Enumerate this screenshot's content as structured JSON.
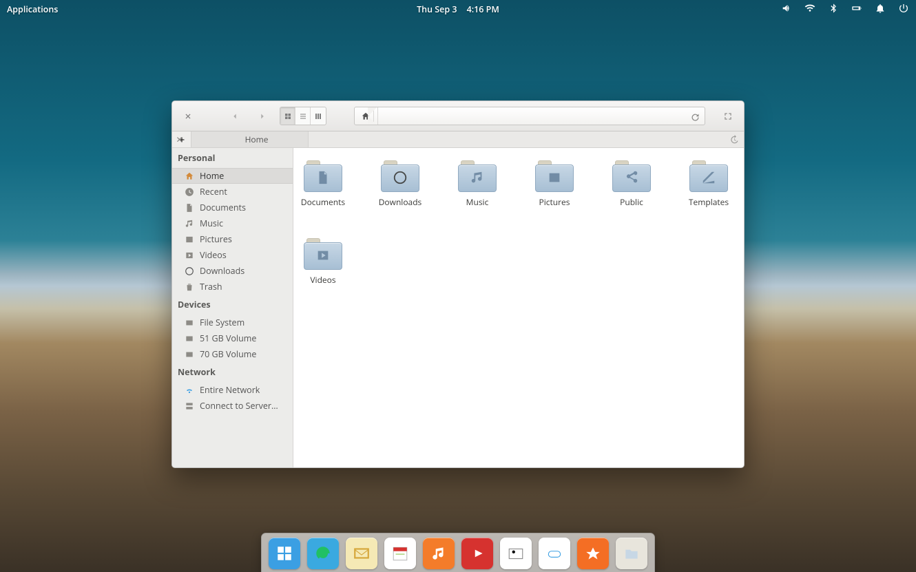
{
  "panel": {
    "applications_label": "Applications",
    "date": "Thu Sep 3",
    "time": "4:16 PM",
    "indicators": [
      "sound-icon",
      "wifi-icon",
      "bluetooth-icon",
      "battery-icon",
      "notifications-icon",
      "power-icon"
    ]
  },
  "filemanager": {
    "tab_label": "Home",
    "breadcrumb": "Home",
    "sidebar": {
      "sections": [
        {
          "title": "Personal",
          "items": [
            {
              "icon": "home",
              "label": "Home",
              "active": true
            },
            {
              "icon": "recent",
              "label": "Recent"
            },
            {
              "icon": "documents",
              "label": "Documents"
            },
            {
              "icon": "music",
              "label": "Music"
            },
            {
              "icon": "pictures",
              "label": "Pictures"
            },
            {
              "icon": "videos",
              "label": "Videos"
            },
            {
              "icon": "downloads",
              "label": "Downloads"
            },
            {
              "icon": "trash",
              "label": "Trash"
            }
          ]
        },
        {
          "title": "Devices",
          "items": [
            {
              "icon": "drive",
              "label": "File System"
            },
            {
              "icon": "drive",
              "label": "51 GB Volume"
            },
            {
              "icon": "drive",
              "label": "70 GB Volume"
            }
          ]
        },
        {
          "title": "Network",
          "items": [
            {
              "icon": "network",
              "label": "Entire Network"
            },
            {
              "icon": "server",
              "label": "Connect to Server…"
            }
          ]
        }
      ]
    },
    "folders": [
      {
        "glyph": "doc",
        "label": "Documents"
      },
      {
        "glyph": "download",
        "label": "Downloads"
      },
      {
        "glyph": "music",
        "label": "Music"
      },
      {
        "glyph": "pictures",
        "label": "Pictures"
      },
      {
        "glyph": "public",
        "label": "Public"
      },
      {
        "glyph": "templates",
        "label": "Templates"
      },
      {
        "glyph": "videos",
        "label": "Videos"
      }
    ]
  },
  "dock": {
    "items": [
      {
        "name": "multitasking",
        "bg": "#3b9fe3",
        "fg": "#fff"
      },
      {
        "name": "web-browser",
        "bg": "#3aa9e0",
        "fg": "#21c064"
      },
      {
        "name": "mail",
        "bg": "#f5e9b5",
        "fg": "#d6a63a"
      },
      {
        "name": "calendar",
        "bg": "#ffffff",
        "fg": "#8bc34a"
      },
      {
        "name": "music",
        "bg": "#f47c2a",
        "fg": "#fff"
      },
      {
        "name": "videos",
        "bg": "#d6322f",
        "fg": "#fff"
      },
      {
        "name": "photos",
        "bg": "#ffffff",
        "fg": "#5aa6e0"
      },
      {
        "name": "switchboard",
        "bg": "#ffffff",
        "fg": "#3b9fe3"
      },
      {
        "name": "appcenter",
        "bg": "#f46e24",
        "fg": "#fff"
      },
      {
        "name": "files",
        "bg": "#e8e5dc",
        "fg": "#8a8577"
      }
    ]
  }
}
